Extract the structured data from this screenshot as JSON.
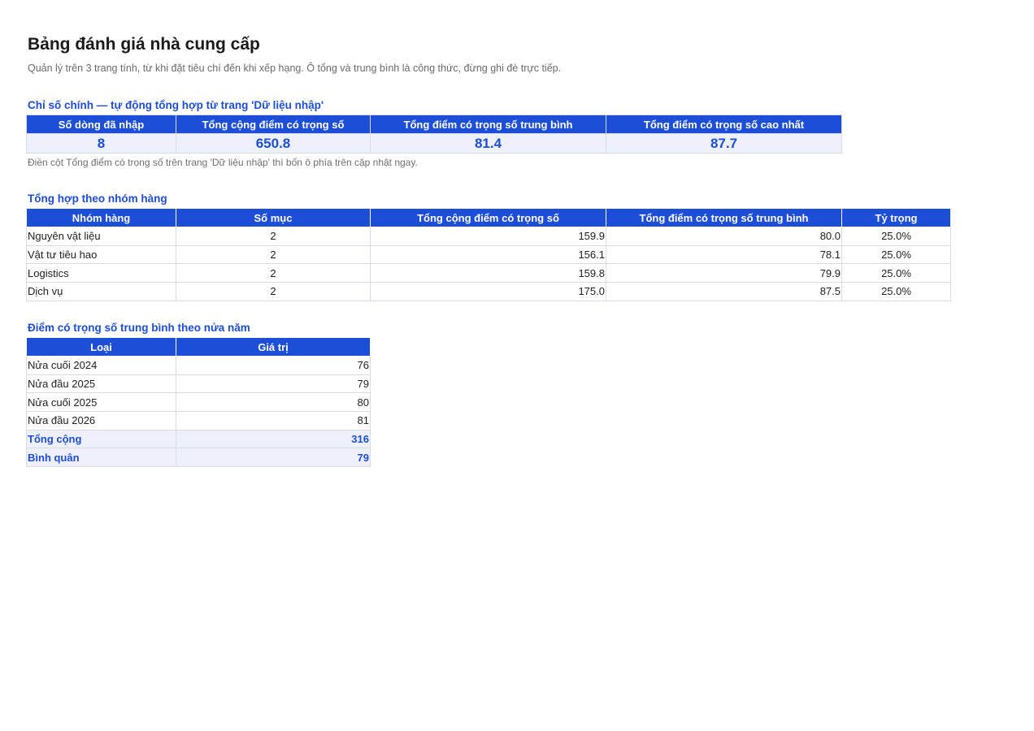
{
  "page": {
    "title": "Bảng đánh giá nhà cung cấp",
    "subtitle": "Quản lý trên 3 trang tính, từ khi đặt tiêu chí đến khi xếp hạng. Ô tổng và trung bình là công thức, đừng ghi đè trực tiếp."
  },
  "kpi": {
    "section_title": "Chỉ số chính — tự động tổng hợp từ trang 'Dữ liệu nhập'",
    "headers": [
      "Số dòng đã nhập",
      "Tổng cộng điểm có trọng số",
      "Tổng điểm có trọng số trung bình",
      "Tổng điểm có trọng số cao nhất"
    ],
    "values": [
      "8",
      "650.8",
      "81.4",
      "87.7"
    ],
    "note": "Điền cột Tổng điểm có trọng số trên trang 'Dữ liệu nhập' thì bốn ô phía trên cập nhật ngay."
  },
  "groups": {
    "section_title": "Tổng hợp theo nhóm hàng",
    "headers": [
      "Nhóm hàng",
      "Số mục",
      "Tổng cộng điểm có trọng số",
      "Tổng điểm có trọng số trung bình",
      "Tỷ trọng"
    ],
    "rows": [
      [
        "Nguyên vật liệu",
        "2",
        "159.9",
        "80.0",
        "25.0%"
      ],
      [
        "Vật tư tiêu hao",
        "2",
        "156.1",
        "78.1",
        "25.0%"
      ],
      [
        "Logistics",
        "2",
        "159.8",
        "79.9",
        "25.0%"
      ],
      [
        "Dịch vụ",
        "2",
        "175.0",
        "87.5",
        "25.0%"
      ]
    ]
  },
  "halfyear": {
    "section_title": "Điểm có trọng số trung bình theo nửa năm",
    "headers": [
      "Loại",
      "Giá trị"
    ],
    "rows": [
      [
        "Nửa cuối 2024",
        "76"
      ],
      [
        "Nửa đầu 2025",
        "79"
      ],
      [
        "Nửa cuối 2025",
        "80"
      ],
      [
        "Nửa đầu 2026",
        "81"
      ]
    ],
    "totals": [
      [
        "Tổng cộng",
        "316"
      ],
      [
        "Bình quân",
        "79"
      ]
    ]
  }
}
